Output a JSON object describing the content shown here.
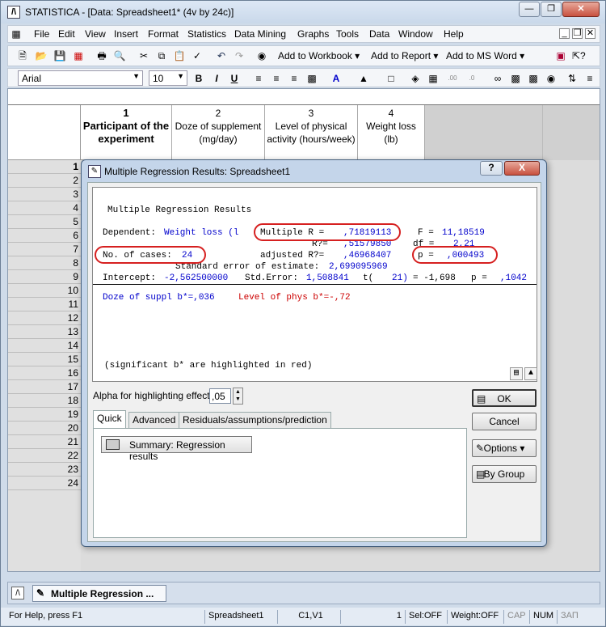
{
  "app": {
    "title": "STATISTICA - [Data: Spreadsheet1* (4v by 24c)]",
    "icon": "statistica-icon"
  },
  "menu": [
    "File",
    "Edit",
    "View",
    "Insert",
    "Format",
    "Statistics",
    "Data Mining",
    "Graphs",
    "Tools",
    "Data",
    "Window",
    "Help"
  ],
  "toolbar": {
    "add_workbook": "Add to Workbook",
    "add_report": "Add to Report",
    "add_msword": "Add to MS Word"
  },
  "format_bar": {
    "font": "Arial",
    "size": "10"
  },
  "sheet": {
    "columns": [
      {
        "num": "1",
        "label": "Participant of the experiment"
      },
      {
        "num": "2",
        "label": "Doze of supplement (mg/day)"
      },
      {
        "num": "3",
        "label": "Level of physical activity (hours/week)"
      },
      {
        "num": "4",
        "label": "Weight loss (lb)"
      }
    ],
    "rows": [
      "1",
      "2",
      "3",
      "4",
      "5",
      "6",
      "7",
      "8",
      "9",
      "10",
      "11",
      "12",
      "13",
      "14",
      "15",
      "16",
      "17",
      "18",
      "19",
      "20",
      "21",
      "22",
      "23",
      "24"
    ]
  },
  "dialog": {
    "title": "Multiple Regression Results: Spreadsheet1",
    "help": "?",
    "close": "X",
    "results": {
      "heading": "Multiple Regression Results",
      "dependent_label": "Dependent:",
      "dependent_value": "Weight loss (l",
      "multiple_r_label": "Multiple R =",
      "multiple_r_value": ",71819113",
      "f_label": "F =",
      "f_value": "11,18519",
      "r2_label": "R?=",
      "r2_value": ",51579850",
      "df_label": "df =",
      "df_value": "2,21",
      "ncases_label": "No. of cases:",
      "ncases_value": "24",
      "adj_r2_label": "adjusted R?=",
      "adj_r2_value": ",46968407",
      "p_label": "p =",
      "p_value": ",000493",
      "se_label": "Standard error of estimate:",
      "se_value": "2,699095969",
      "intercept_label": "Intercept:",
      "intercept_value": "-2,562500000",
      "stderr_label": "Std.Error:",
      "stderr_value": "1,508841",
      "t_label": "t(",
      "t_df": "21)",
      "t_value": "= -1,698",
      "p2_label": "p =",
      "p2_value": ",1042",
      "b1": "Doze of suppl b*=,036",
      "b2": "Level of phys b*=-,72",
      "note": "(significant b* are highlighted in red)"
    },
    "alpha_label": "Alpha for highlighting effects:",
    "alpha_value": ",05",
    "tabs": [
      "Quick",
      "Advanced",
      "Residuals/assumptions/prediction"
    ],
    "summary_button": "Summary:  Regression results",
    "buttons": {
      "ok": "OK",
      "cancel": "Cancel",
      "options": "Options",
      "bygroup": "By Group"
    }
  },
  "taskbar": {
    "item": "Multiple Regression ..."
  },
  "status": {
    "help": "For Help, press F1",
    "sheet": "Spreadsheet1",
    "cell": "C1,V1",
    "count": "1",
    "sel": "Sel:OFF",
    "weight": "Weight:OFF",
    "cap": "CAP",
    "num": "NUM",
    "scrl": "ЗАП"
  },
  "colors": {
    "accent_red": "#cc0000",
    "accent_blue": "#0000cc"
  }
}
